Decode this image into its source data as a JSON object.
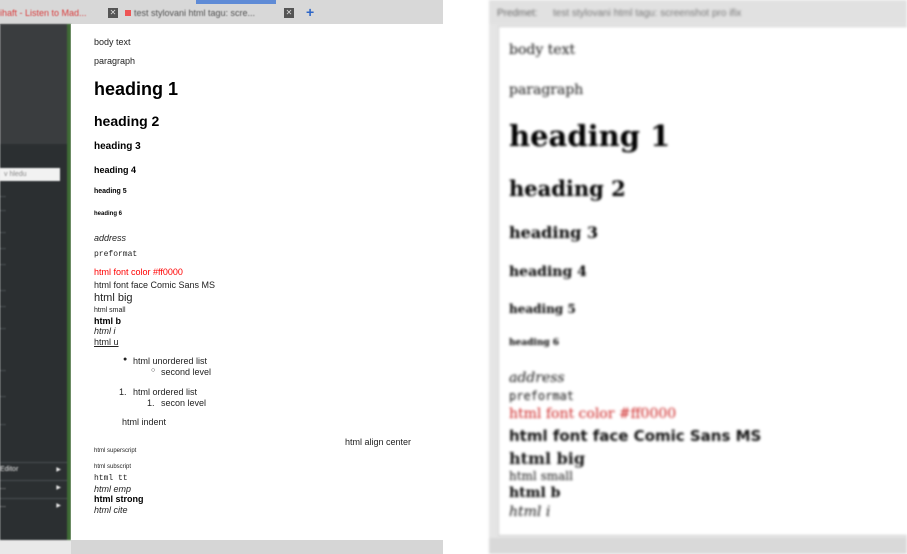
{
  "left_window": {
    "tabs": {
      "tab1_label": "ihaft - Listen to Mad...",
      "tab2_label": "test stylovani html tagu: scre..."
    },
    "sidebar": {
      "search_placeholder": "v hledu",
      "items": [
        "...",
        "...",
        "...",
        "...",
        "...",
        "...",
        "...",
        "...",
        "...",
        "...",
        "..."
      ],
      "sections": [
        "Editor",
        "...",
        "..."
      ]
    },
    "lines": {
      "body_text": "body text",
      "paragraph": "paragraph",
      "h1": "heading 1",
      "h2": "heading 2",
      "h3": "heading 3",
      "h4": "heading 4",
      "h5": "heading 5",
      "h6": "heading 6",
      "address": "address",
      "preformat": "preformat",
      "font_color": "html font color #ff0000",
      "font_face": "html font face Comic Sans MS",
      "big": "html big",
      "small": "html small",
      "b": "html b",
      "i": "html i",
      "u": "html u",
      "ul_item": "html unordered list",
      "ul_sub": "second level",
      "ol_item": "html ordered list",
      "ol_sub": "secon level",
      "indent": "html indent",
      "center": "html align center",
      "superscript": "html superscript",
      "subscript": "html subscript",
      "tt": "html tt",
      "emp": "html emp",
      "strong": "html strong",
      "cite": "html cite"
    },
    "ol_num1": "1.",
    "ol_num2": "1.",
    "ul_bullet": "●",
    "ul_sub_bullet": "○"
  },
  "right_window": {
    "header_label": "Predmet:",
    "header_value": "test stylovani html tagu: screenshot pro ifix",
    "lines": {
      "body_text": "body text",
      "paragraph": "paragraph",
      "h1": "heading 1",
      "h2": "heading 2",
      "h3": "heading 3",
      "h4": "heading 4",
      "h5": "heading 5",
      "h6": "heading 6",
      "address": "address",
      "preformat": "preformat",
      "font_color": "html font color #ff0000",
      "font_face": "html font face Comic Sans MS",
      "big": "html big",
      "small": "html small",
      "b": "html b",
      "i": "html i"
    }
  },
  "colors": {
    "red_text": "#ff0000",
    "sidebar_dark": "#2b2f31",
    "accent_blue": "#2e66c7",
    "accent_green": "#3f6b35"
  }
}
